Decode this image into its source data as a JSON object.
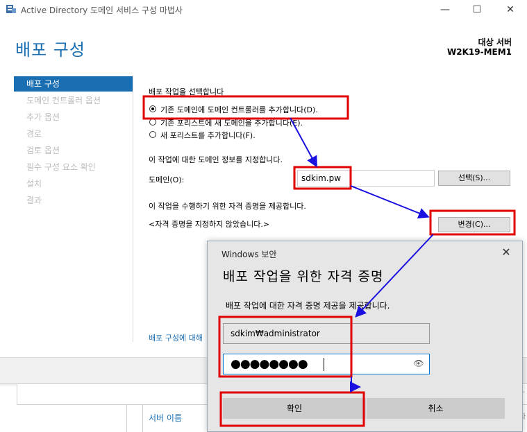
{
  "window": {
    "title": "Active Directory 도메인 서비스 구성 마법사",
    "minimize_glyph": "—",
    "maximize_glyph": "☐",
    "close_glyph": "✕"
  },
  "wizard": {
    "title": "배포 구성",
    "target_label": "대상 서버",
    "target_name": "W2K19-MEM1"
  },
  "nav": {
    "items": [
      {
        "label": "배포 구성",
        "active": true
      },
      {
        "label": "도메인 컨트롤러 옵션"
      },
      {
        "label": "추가 옵션"
      },
      {
        "label": "경로"
      },
      {
        "label": "검토 옵션"
      },
      {
        "label": "필수 구성 요소 확인"
      },
      {
        "label": "설치"
      },
      {
        "label": "결과"
      }
    ]
  },
  "content": {
    "select_operation": "배포 작업을 선택합니다",
    "options": [
      {
        "label": "기존 도메인에 도메인 컨트롤러를 추가합니다(D).",
        "checked": true
      },
      {
        "label": "기존 포리스트에 새 도메인을 추가합니다(E)."
      },
      {
        "label": "새 포리스트를 추가합니다(F)."
      }
    ],
    "domain_info": "이 작업에 대한 도메인 정보를 지정합니다.",
    "domain_label": "도메인(O):",
    "domain_value": "sdkim.pw",
    "select_button": "선택(S)...",
    "credentials_info": "이 작업을 수행하기 위한 자격 증명을 제공합니다.",
    "credentials_status": "<자격 증명을 지정하지 않았습니다.>",
    "change_button": "변경(C)...",
    "more_link": "배포 구성에 대해"
  },
  "background": {
    "server_name_column": "서버 이름",
    "edge_text_1": "ㄴ",
    "edge_text_2": "자"
  },
  "dialog": {
    "caption": "Windows 보안",
    "close_glyph": "✕",
    "heading": "배포 작업을 위한 자격 증명",
    "instruction": "배포 작업에 대한 자격 증명 제공을 제공합니다.",
    "username": "sdkim₩administrator",
    "password_mask": "●●●●●●●●",
    "reveal_icon": "👁",
    "ok_button": "확인",
    "cancel_button": "취소"
  },
  "colors": {
    "accent": "#1a6fb3",
    "annotation_red": "#e00000",
    "annotation_blue": "#1a10e0"
  }
}
